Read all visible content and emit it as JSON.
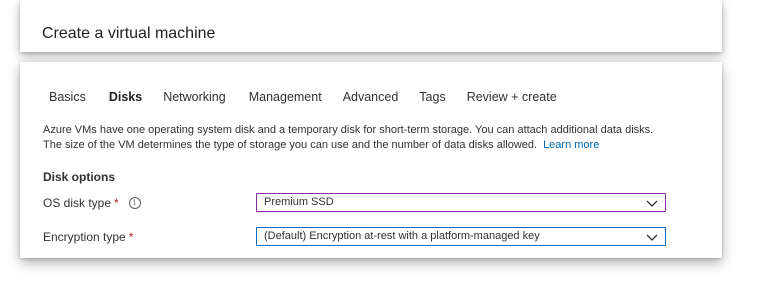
{
  "page": {
    "title": "Create a virtual machine"
  },
  "tabs": [
    {
      "label": "Basics"
    },
    {
      "label": "Disks"
    },
    {
      "label": "Networking"
    },
    {
      "label": "Management"
    },
    {
      "label": "Advanced"
    },
    {
      "label": "Tags"
    },
    {
      "label": "Review + create"
    }
  ],
  "active_tab": "Disks",
  "intro": {
    "line1": "Azure VMs have one operating system disk and a temporary disk for short-term storage. You can attach additional data disks.",
    "line2": "The size of the VM determines the type of storage you can use and the number of data disks allowed.",
    "learn_more": "Learn more"
  },
  "disk_options": {
    "section_title": "Disk options",
    "os_disk_type": {
      "label": "OS disk type",
      "required_mark": "*",
      "info_icon": "info-icon",
      "value": "Premium SSD"
    },
    "encryption_type": {
      "label": "Encryption type",
      "required_mark": "*",
      "value": "(Default) Encryption at-rest with a platform-managed key"
    }
  },
  "colors": {
    "accent_link": "#0067b8",
    "required": "#a4262c",
    "select_border": "#8a2da5",
    "focus_border": "#0f6cbd"
  }
}
